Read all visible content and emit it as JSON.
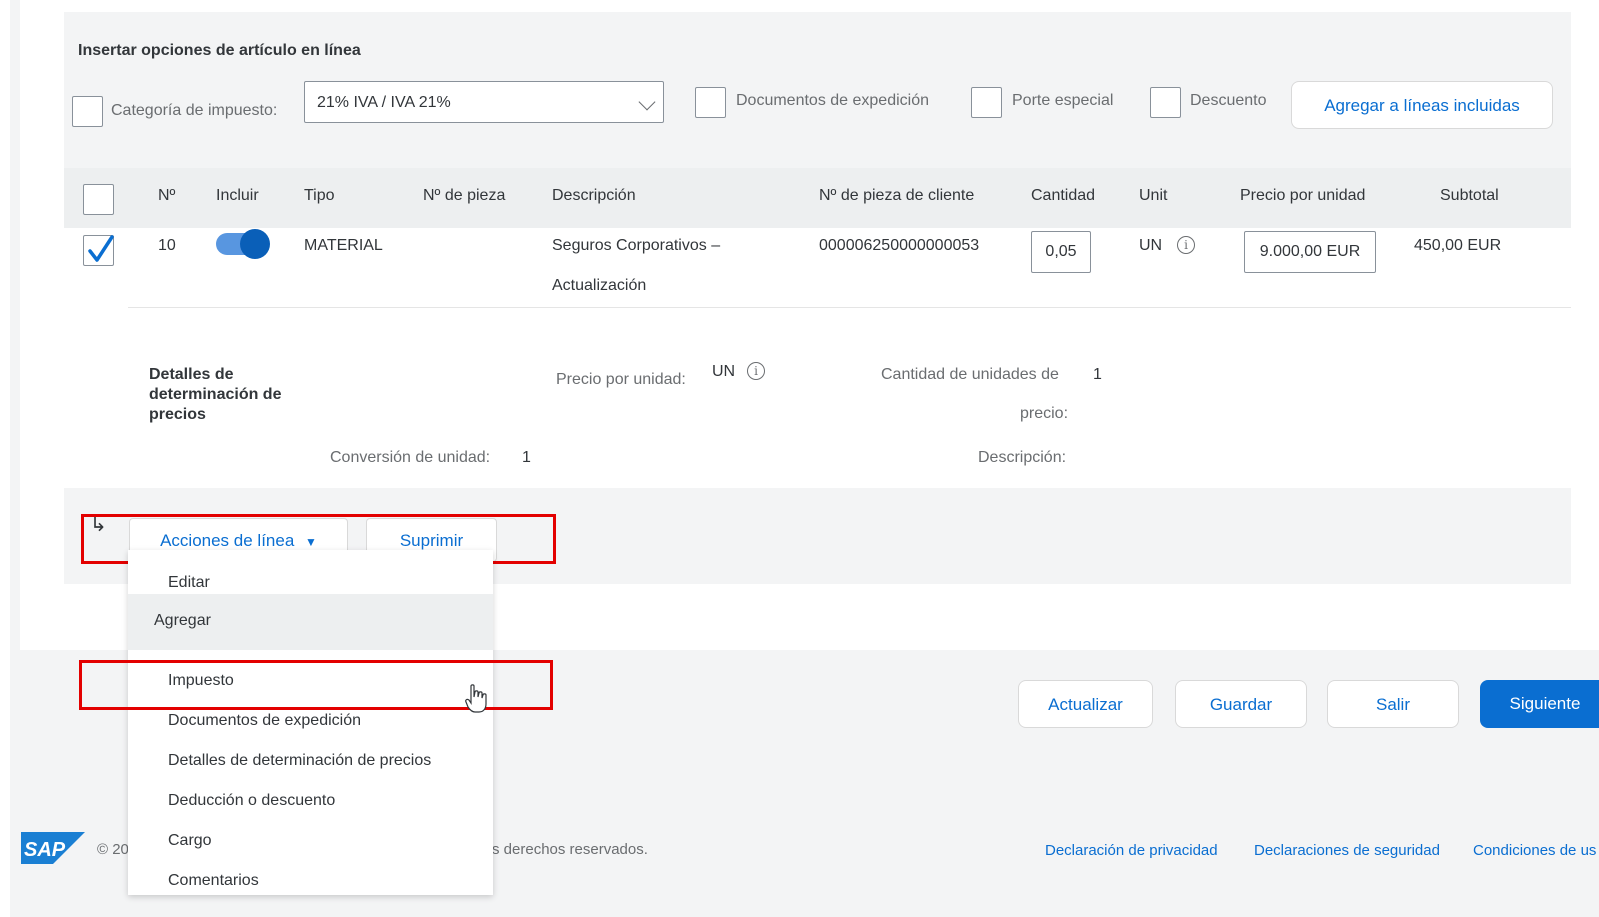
{
  "inline_options": {
    "title": "Insertar opciones de artículo en línea",
    "tax_category_label": "Categoría de impuesto:",
    "tax_category_value": "21% IVA / IVA 21%",
    "shipping_docs_label": "Documentos de expedición",
    "special_handling_label": "Porte especial",
    "discount_label": "Descuento",
    "add_button": "Agregar a líneas incluidas"
  },
  "table": {
    "headers": {
      "no": "Nº",
      "include": "Incluir",
      "type": "Tipo",
      "part_no": "Nº de pieza",
      "description": "Descripción",
      "customer_part": "Nº de pieza de cliente",
      "quantity": "Cantidad",
      "unit": "Unit",
      "unit_price": "Precio por unidad",
      "subtotal": "Subtotal"
    },
    "row": {
      "no": "10",
      "type": "MATERIAL",
      "description_line1": "Seguros Corporativos –",
      "description_line2": "Actualización",
      "customer_part": "000006250000000053",
      "quantity": "0,05",
      "unit": "UN",
      "unit_price": "9.000,00 EUR",
      "subtotal": "450,00 EUR"
    }
  },
  "pricing_details": {
    "title": "Detalles de determinación de precios",
    "price_per_unit_label": "Precio por unidad:",
    "price_per_unit_value": "UN",
    "price_units_label_1": "Cantidad de unidades de",
    "price_units_label_2": "precio:",
    "price_units_value": "1",
    "unit_conversion_label": "Conversión de unidad:",
    "unit_conversion_value": "1",
    "description_label": "Descripción:"
  },
  "line_actions": {
    "arrow": "↳",
    "actions_button": "Acciones de línea",
    "actions_caret": "▼",
    "delete_button": "Suprimir"
  },
  "dropdown": {
    "edit": "Editar",
    "add_group": "Agregar",
    "items": [
      "Impuesto",
      "Documentos de expedición",
      "Detalles de determinación de precios",
      "Deducción o descuento",
      "Cargo",
      "Comentarios"
    ]
  },
  "bottom_buttons": {
    "update": "Actualizar",
    "save": "Guardar",
    "exit": "Salir",
    "next": "Siguiente"
  },
  "footer": {
    "logo": "SAP",
    "copyright_start": "© 20",
    "copyright_end": "s derechos reservados.",
    "privacy": "Declaración de privacidad",
    "security": "Declaraciones de seguridad",
    "terms": "Condiciones de us"
  },
  "colors": {
    "accent": "#0a6ed1",
    "highlight": "#e30000"
  },
  "info_icon_glyph": "i"
}
